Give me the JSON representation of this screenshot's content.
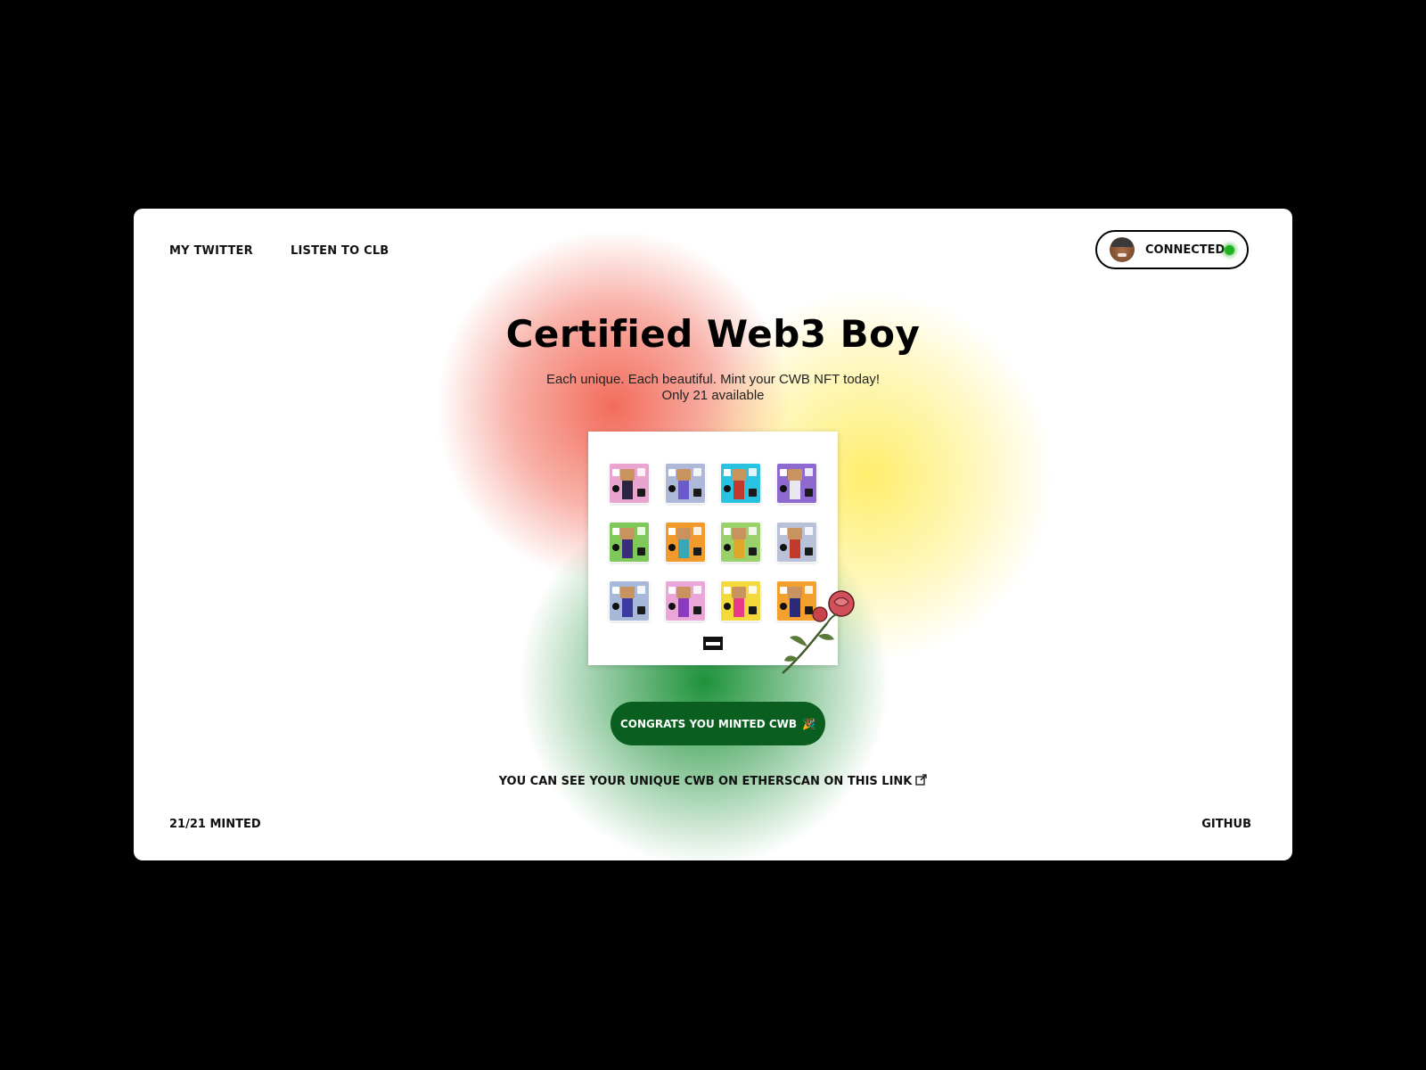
{
  "nav": {
    "twitter_label": "MY TWITTER",
    "clb_label": "LISTEN TO CLB"
  },
  "wallet": {
    "status_label": "CONNECTED",
    "status_color": "#22b020"
  },
  "hero": {
    "title": "Certified Web3 Boy",
    "subtitle_line1": "Each unique. Each beautiful. Mint your CWB NFT today!",
    "subtitle_line2": "Only 21 available"
  },
  "collection": {
    "tiles": [
      {
        "bg": "#e9a5d0",
        "shirt": "#2a2440"
      },
      {
        "bg": "#aeb8d8",
        "shirt": "#6a5acd"
      },
      {
        "bg": "#29c2e0",
        "shirt": "#c0392b"
      },
      {
        "bg": "#8e6ad0",
        "shirt": "#e8e8ee"
      },
      {
        "bg": "#7fc95a",
        "shirt": "#3a2c7a"
      },
      {
        "bg": "#f39a2c",
        "shirt": "#3aa7b8"
      },
      {
        "bg": "#9bd16a",
        "shirt": "#e0a72b"
      },
      {
        "bg": "#b9c1d9",
        "shirt": "#c0392b"
      },
      {
        "bg": "#a8b8d8",
        "shirt": "#3a3aa0"
      },
      {
        "bg": "#eaa6d8",
        "shirt": "#8a3ac0"
      },
      {
        "bg": "#f3d93a",
        "shirt": "#e83a8a"
      },
      {
        "bg": "#f3a02c",
        "shirt": "#2a2a7a"
      }
    ]
  },
  "accent_colors": {
    "mint_button": "#0a5e1f",
    "glow_red": "#f0523e",
    "glow_yellow": "#ffe83c",
    "glow_green": "#128c30"
  },
  "mint": {
    "button_label": "CONGRATS YOU MINTED CWB",
    "button_emoji": "🎉"
  },
  "etherscan": {
    "link_text": "YOU CAN SEE YOUR UNIQUE CWB ON ETHERSCAN ON THIS LINK"
  },
  "footer": {
    "minted_count": "21/21 MINTED",
    "github_label": "GITHUB"
  }
}
